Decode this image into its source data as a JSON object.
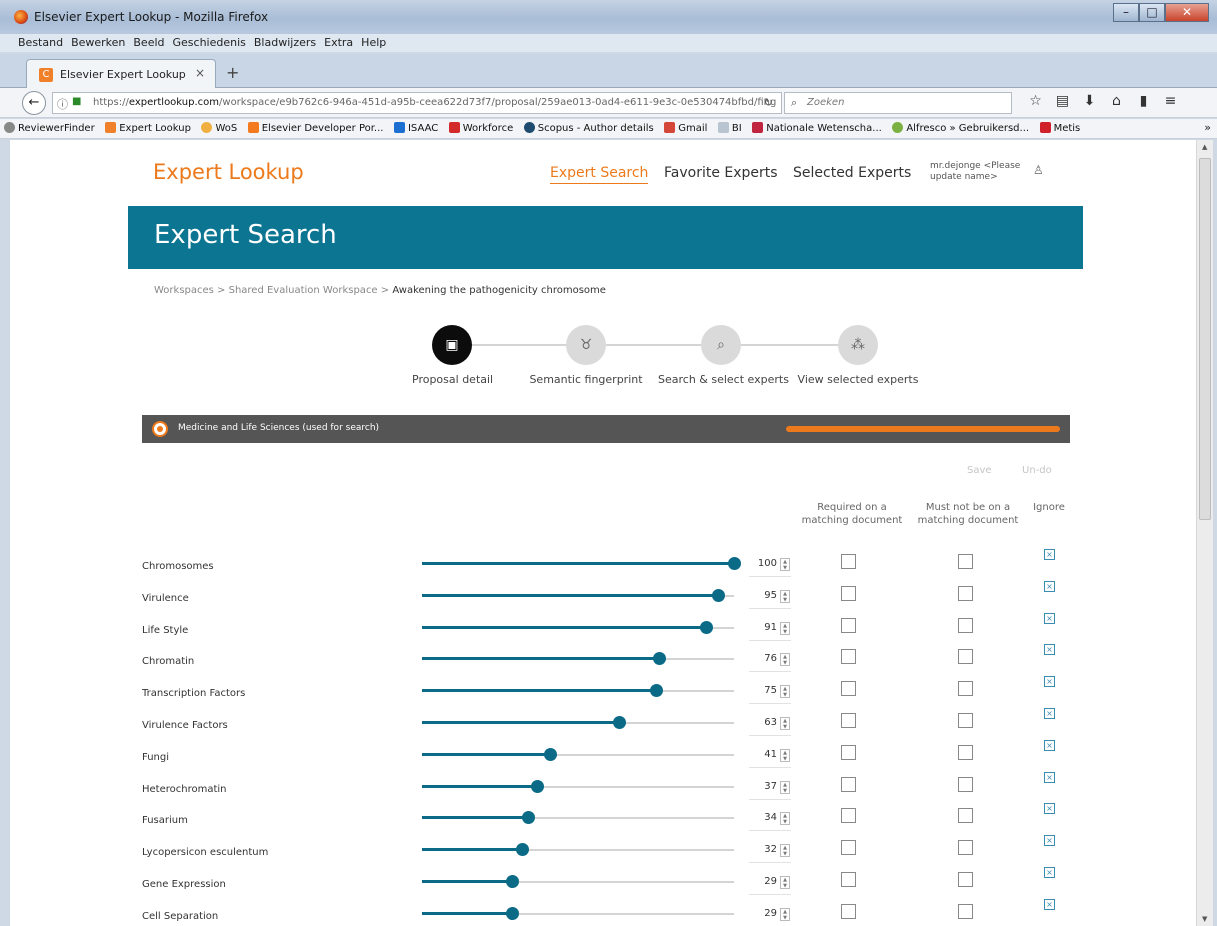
{
  "window": {
    "title": "Elsevier Expert Lookup - Mozilla Firefox"
  },
  "menu": [
    "Bestand",
    "Bewerken",
    "Beeld",
    "Geschiedenis",
    "Bladwijzers",
    "Extra",
    "Help"
  ],
  "tab": {
    "label": "Elsevier Expert Lookup"
  },
  "address": {
    "host": "expertlookup.com",
    "prefix": "https://",
    "path": "/workspace/e9b762c6-946a-451d-a95b-ceea622d73f7/proposal/259ae013-0ad4-e611-9e3c-0e530474bfbd/fing",
    "search_placeholder": "Zoeken"
  },
  "bookmarks": [
    "ReviewerFinder",
    "Expert Lookup",
    "WoS",
    "Elsevier Developer Por...",
    "ISAAC",
    "Workforce",
    "Scopus - Author details",
    "Gmail",
    "BI",
    "Nationale Wetenscha...",
    "Alfresco » Gebruikersd...",
    "Metis"
  ],
  "site": {
    "brand": "Expert Lookup",
    "nav": {
      "expert_search": "Expert Search",
      "favorite": "Favorite Experts",
      "selected": "Selected Experts"
    },
    "user": "mr.dejonge <Please update name>"
  },
  "hero_title": "Expert Search",
  "breadcrumb": {
    "links": "Workspaces > Shared Evaluation Workspace > ",
    "current": "Awakening the pathogenicity chromosome"
  },
  "steps": [
    "Proposal detail",
    "Semantic fingerprint",
    "Search & select experts",
    "View selected experts"
  ],
  "category": {
    "label": "Medicine and Life Sciences (used for search)",
    "progress": 1.0
  },
  "actions": {
    "save": "Save",
    "undo": "Un-do"
  },
  "columns": {
    "required": "Required on a matching document",
    "must_not": "Must not be on a matching document",
    "ignore": "Ignore"
  },
  "terms": [
    {
      "name": "Chromosomes",
      "value": 100
    },
    {
      "name": "Virulence",
      "value": 95
    },
    {
      "name": "Life Style",
      "value": 91
    },
    {
      "name": "Chromatin",
      "value": 76
    },
    {
      "name": "Transcription Factors",
      "value": 75
    },
    {
      "name": "Virulence Factors",
      "value": 63
    },
    {
      "name": "Fungi",
      "value": 41
    },
    {
      "name": "Heterochromatin",
      "value": 37
    },
    {
      "name": "Fusarium",
      "value": 34
    },
    {
      "name": "Lycopersicon esculentum",
      "value": 32
    },
    {
      "name": "Gene Expression",
      "value": 29
    },
    {
      "name": "Cell Separation",
      "value": 29
    }
  ]
}
